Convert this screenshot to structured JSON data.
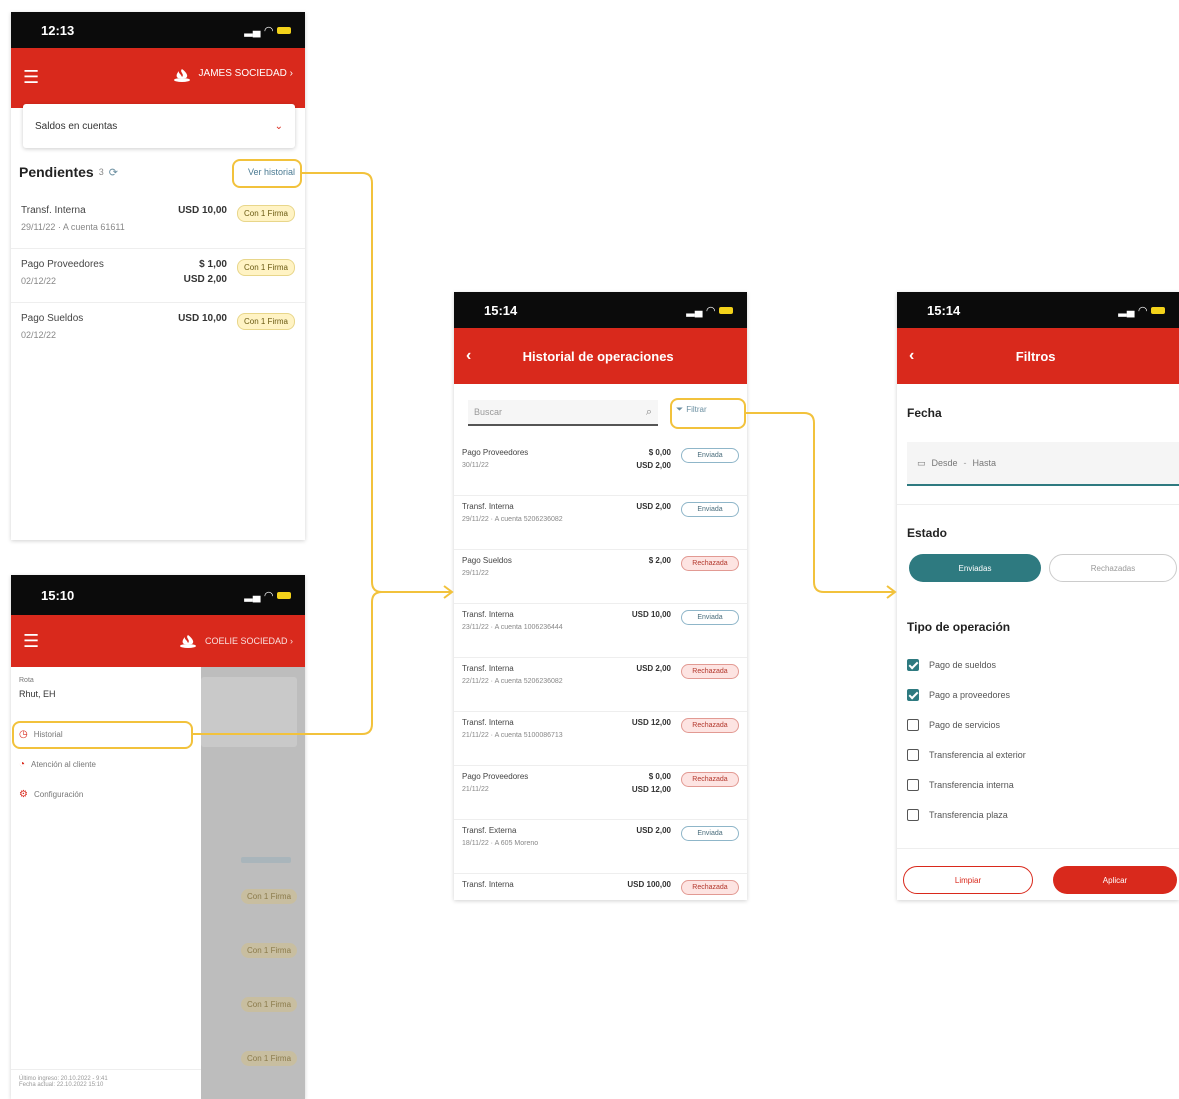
{
  "screen1": {
    "time": "12:13",
    "company": "JAMES SOCIEDAD",
    "dropdown": "Saldos en cuentas",
    "pending_title": "Pendientes",
    "pending_count": "3",
    "history_link": "Ver historial",
    "rows": [
      {
        "title": "Transf. Interna",
        "date": "29/11/22 · A cuenta 61611",
        "amt1": "USD 10,00",
        "amt2": "",
        "badge": "Con 1 Firma"
      },
      {
        "title": "Pago Proveedores",
        "date": "02/12/22",
        "amt1": "$ 1,00",
        "amt2": "USD 2,00",
        "badge": "Con 1 Firma"
      },
      {
        "title": "Pago Sueldos",
        "date": "02/12/22",
        "amt1": "USD 10,00",
        "amt2": "",
        "badge": "Con 1 Firma"
      }
    ]
  },
  "screen2": {
    "time": "15:10",
    "company": "COELIE SOCIEDAD",
    "profile_label": "Rota",
    "profile_name": "Rhut, EH",
    "menu": [
      {
        "label": "Historial",
        "icon": "clock-icon"
      },
      {
        "label": "Atención al cliente",
        "icon": "headset-icon"
      },
      {
        "label": "Configuración",
        "icon": "gear-icon"
      }
    ],
    "footer_line1": "Último ingreso: 20.10.2022 - 9:41",
    "footer_line2": "Fecha actual: 22.10.2022 15:10",
    "bg_badges": [
      "Con 1 Firma",
      "Con 1 Firma",
      "Con 1 Firma",
      "Con 1 Firma"
    ]
  },
  "screen3": {
    "time": "15:14",
    "title": "Historial de operaciones",
    "search_placeholder": "Buscar",
    "filter_label": "Filtrar",
    "rows": [
      {
        "title": "Pago Proveedores",
        "date": "30/11/22",
        "amt1": "$ 0,00",
        "amt2": "USD 2,00",
        "badge": "Enviada",
        "status": "blue"
      },
      {
        "title": "Transf. Interna",
        "date": "29/11/22 · A cuenta 5206236082",
        "amt1": "USD 2,00",
        "amt2": "",
        "badge": "Enviada",
        "status": "blue"
      },
      {
        "title": "Pago Sueldos",
        "date": "29/11/22",
        "amt1": "$ 2,00",
        "amt2": "",
        "badge": "Rechazada",
        "status": "red"
      },
      {
        "title": "Transf. Interna",
        "date": "23/11/22 · A cuenta 1006236444",
        "amt1": "USD 10,00",
        "amt2": "",
        "badge": "Enviada",
        "status": "blue"
      },
      {
        "title": "Transf. Interna",
        "date": "22/11/22 · A cuenta 5206236082",
        "amt1": "USD 2,00",
        "amt2": "",
        "badge": "Rechazada",
        "status": "red"
      },
      {
        "title": "Transf. Interna",
        "date": "21/11/22 · A cuenta 5100086713",
        "amt1": "USD 12,00",
        "amt2": "",
        "badge": "Rechazada",
        "status": "red"
      },
      {
        "title": "Pago Proveedores",
        "date": "21/11/22",
        "amt1": "$ 0,00",
        "amt2": "USD 12,00",
        "badge": "Rechazada",
        "status": "red"
      },
      {
        "title": "Transf. Externa",
        "date": "18/11/22 · A 605 Moreno",
        "amt1": "USD 2,00",
        "amt2": "",
        "badge": "Enviada",
        "status": "blue"
      },
      {
        "title": "Transf. Interna",
        "date": "",
        "amt1": "USD 100,00",
        "amt2": "",
        "badge": "Rechazada",
        "status": "red"
      }
    ]
  },
  "screen4": {
    "time": "15:14",
    "title": "Filtros",
    "fecha_label": "Fecha",
    "date_from": "Desde",
    "date_to": "Hasta",
    "estado_label": "Estado",
    "estado_options": [
      "Enviadas",
      "Rechazadas"
    ],
    "tipo_label": "Tipo de operación",
    "tipos": [
      {
        "label": "Pago de sueldos",
        "checked": true
      },
      {
        "label": "Pago a proveedores",
        "checked": true
      },
      {
        "label": "Pago de servicios",
        "checked": false
      },
      {
        "label": "Transferencia al exterior",
        "checked": false
      },
      {
        "label": "Transferencia interna",
        "checked": false
      },
      {
        "label": "Transferencia plaza",
        "checked": false
      }
    ],
    "clear_label": "Limpiar",
    "apply_label": "Aplicar"
  },
  "colors": {
    "brand_red": "#d9291c",
    "highlight": "#f2c23c",
    "teal": "#2e7a80"
  }
}
